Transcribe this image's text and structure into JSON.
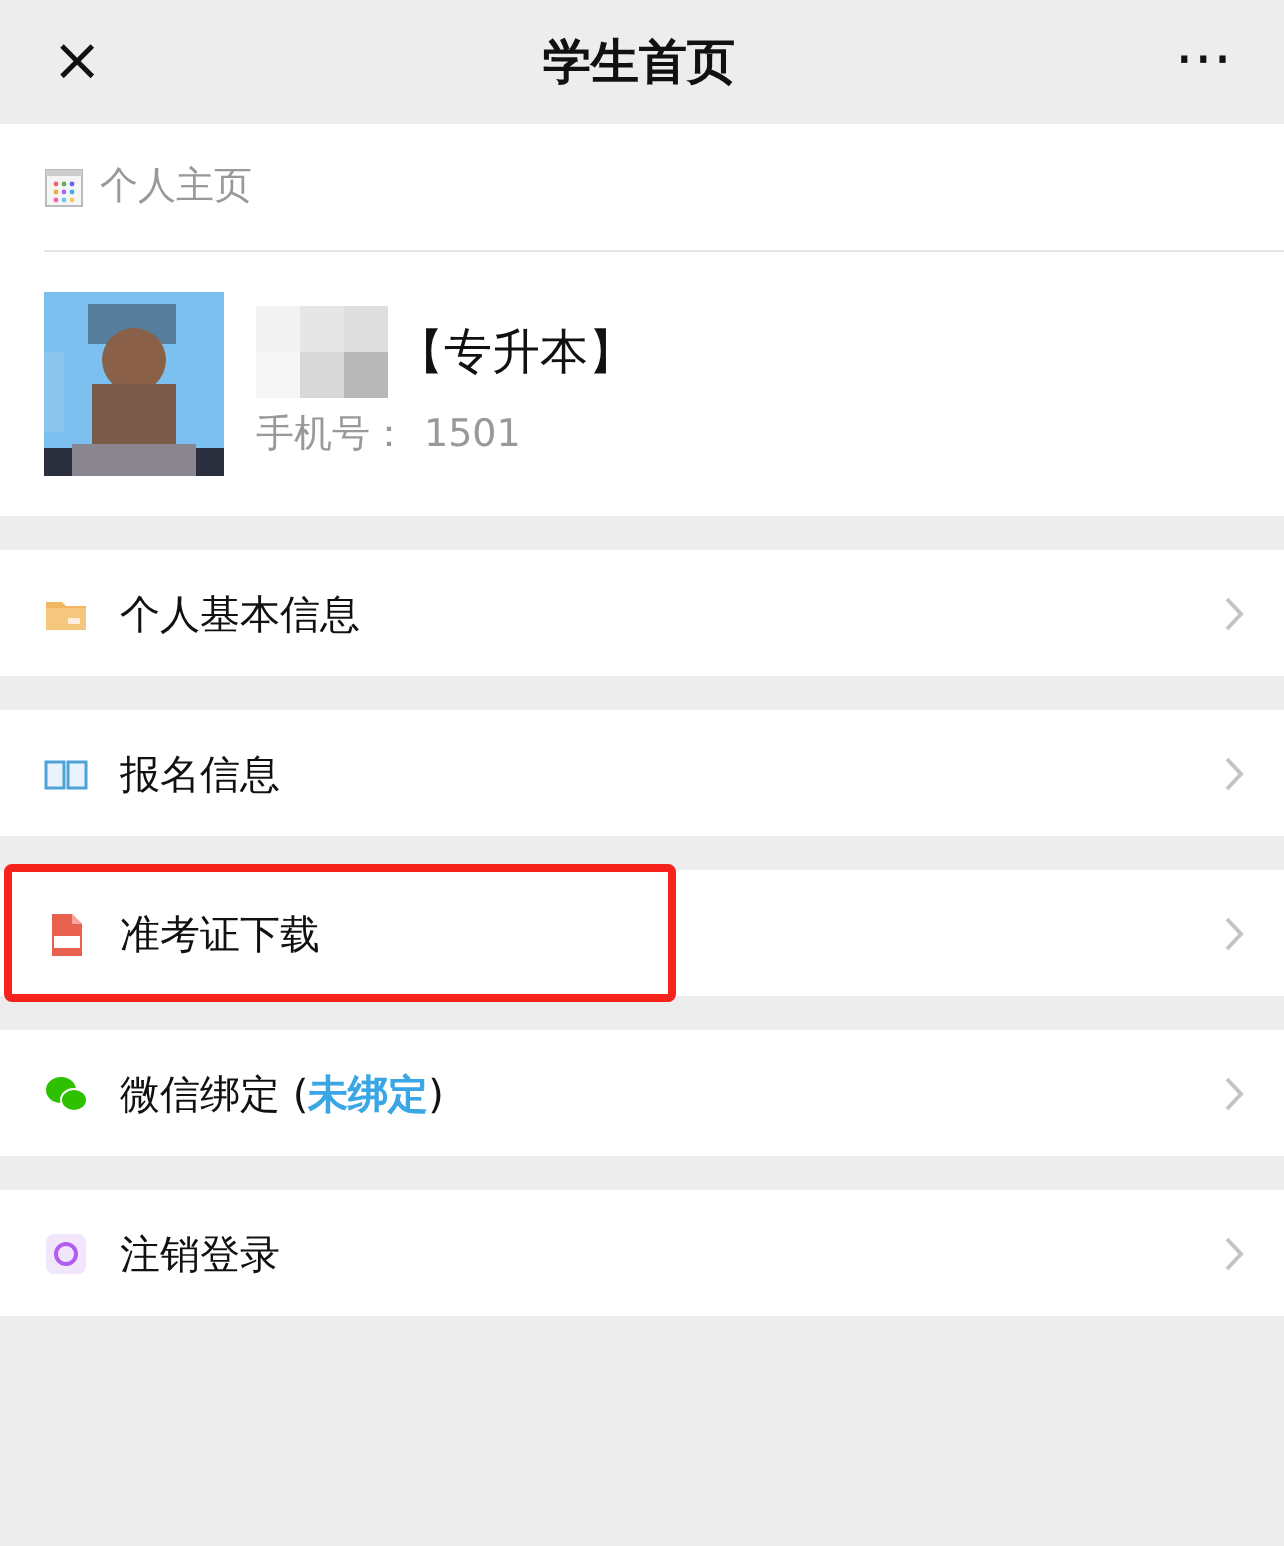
{
  "top_bar": {
    "close": "×",
    "title": "学生首页",
    "more": "···"
  },
  "profile": {
    "section_title": "个人主页",
    "tag": "【专升本】",
    "phone_label": "手机号：",
    "phone": "1501"
  },
  "menu": [
    {
      "label": "个人基本信息",
      "highlighted": false
    },
    {
      "label": "报名信息",
      "highlighted": false
    },
    {
      "label": "准考证下载",
      "highlighted": true
    },
    {
      "label": "微信绑定 (",
      "status": "未绑定",
      "label_end": ")",
      "highlighted": false
    },
    {
      "label": "注销登录",
      "highlighted": false
    }
  ]
}
